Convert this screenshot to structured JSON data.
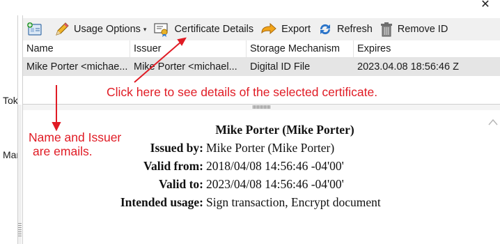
{
  "window": {
    "close_glyph": "✕",
    "left_fragments": [
      "Tok",
      "Man"
    ]
  },
  "toolbar": {
    "items": [
      {
        "label": "",
        "icon": "add-id-icon"
      },
      {
        "label": "Usage Options",
        "icon": "pencil-icon"
      },
      {
        "label": "Certificate Details",
        "icon": "certificate-icon"
      },
      {
        "label": "Export",
        "icon": "export-arrow-icon"
      },
      {
        "label": "Refresh",
        "icon": "refresh-icon"
      },
      {
        "label": "Remove ID",
        "icon": "trash-icon"
      }
    ]
  },
  "table": {
    "columns": [
      "Name",
      "Issuer",
      "Storage Mechanism",
      "Expires"
    ],
    "rows": [
      [
        "Mike Porter <michae...",
        "Mike Porter <michael...",
        "Digital ID File",
        "2023.04.08 18:56:46 Z"
      ]
    ]
  },
  "details": {
    "title": "Mike Porter (Mike Porter)",
    "fields": [
      {
        "label": "Issued by:",
        "value": "Mike Porter (Mike Porter)"
      },
      {
        "label": "Valid from:",
        "value": "2018/04/08 14:56:46 -04'00'"
      },
      {
        "label": "Valid to:",
        "value": "2023/04/08 14:56:46 -04'00'"
      },
      {
        "label": "Intended usage:",
        "value": "Sign transaction, Encrypt document"
      }
    ]
  },
  "annotations": {
    "details_hint": "Click here to see details of the selected certificate.",
    "email_hint_line1": "Name and Issuer",
    "email_hint_line2": "are emails.",
    "color": "#e01b24"
  }
}
